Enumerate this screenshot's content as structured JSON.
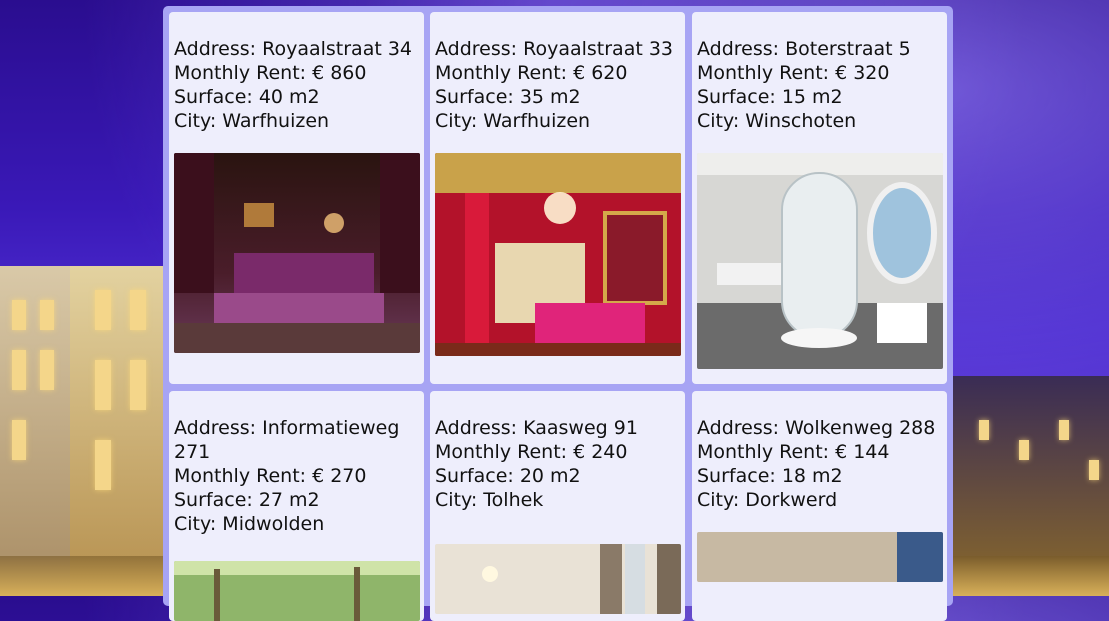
{
  "listings": [
    {
      "address": "Address: Royaalstraat 34",
      "rent": "Monthly Rent: € 860",
      "surface": "Surface: 40 m2",
      "city": "City: Warfhuizen",
      "image": "gothic-bedroom-photo"
    },
    {
      "address": "Address: Royaalstraat 33",
      "rent": "Monthly Rent: € 620",
      "surface": "Surface: 35 m2",
      "city": "City: Warfhuizen",
      "image": "royal-red-bedroom-photo"
    },
    {
      "address": "Address: Boterstraat 5",
      "rent": "Monthly Rent: € 320",
      "surface": "Surface: 15 m2",
      "city": "City: Winschoten",
      "image": "modern-bathroom-photo"
    },
    {
      "address": "Address: Informatieweg 271",
      "rent": "Monthly Rent: € 270",
      "surface": "Surface: 27 m2",
      "city": "City: Midwolden",
      "image": "garden-photo"
    },
    {
      "address": "Address: Kaasweg 91",
      "rent": "Monthly Rent: € 240",
      "surface": "Surface: 20 m2",
      "city": "City: Tolhek",
      "image": "room-photo"
    },
    {
      "address": "Address: Wolkenweg 288",
      "rent": "Monthly Rent: € 144",
      "surface": "Surface: 18 m2",
      "city": "City: Dorkwerd",
      "image": "interior-photo"
    }
  ]
}
